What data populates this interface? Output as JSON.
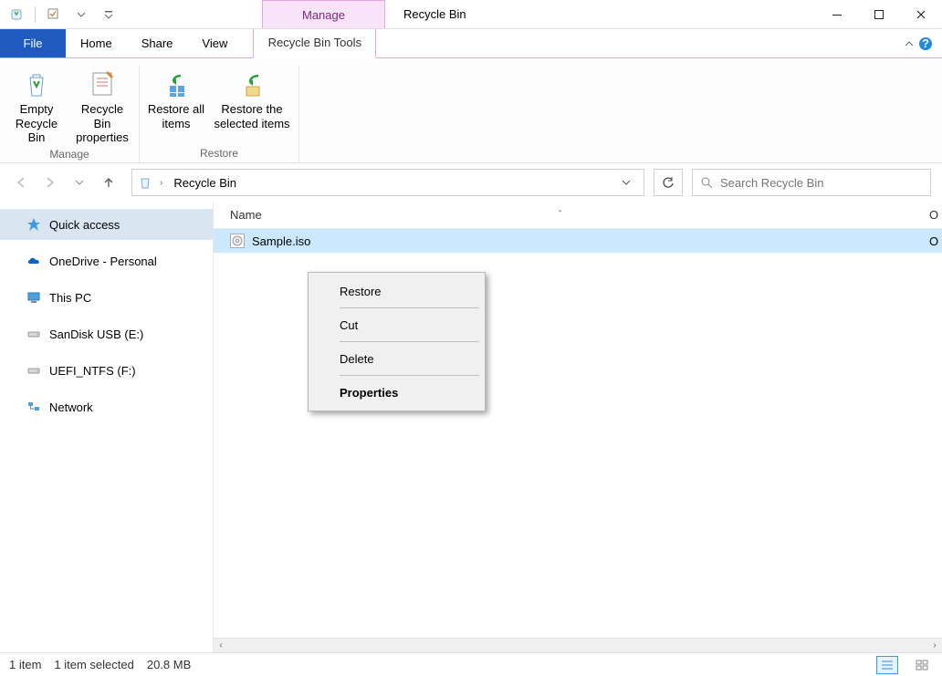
{
  "titlebar": {
    "context_label": "Manage",
    "title": "Recycle Bin"
  },
  "tabs": {
    "file": "File",
    "home": "Home",
    "share": "Share",
    "view": "View",
    "tools": "Recycle Bin Tools"
  },
  "ribbon": {
    "manage": {
      "empty": "Empty Recycle Bin",
      "properties": "Recycle Bin properties",
      "caption": "Manage"
    },
    "restore": {
      "all": "Restore all items",
      "selected": "Restore the selected items",
      "caption": "Restore"
    }
  },
  "address": {
    "location": "Recycle Bin"
  },
  "search": {
    "placeholder": "Search Recycle Bin"
  },
  "nav": {
    "quick_access": "Quick access",
    "onedrive": "OneDrive - Personal",
    "this_pc": "This PC",
    "sandisk": "SanDisk USB (E:)",
    "uefi": "UEFI_NTFS (F:)",
    "network": "Network"
  },
  "columns": {
    "name": "Name",
    "other": "O"
  },
  "files": [
    {
      "name": "Sample.iso",
      "other": "O"
    }
  ],
  "context_menu": {
    "restore": "Restore",
    "cut": "Cut",
    "delete": "Delete",
    "properties": "Properties"
  },
  "status": {
    "count": "1 item",
    "selected": "1 item selected",
    "size": "20.8 MB"
  }
}
